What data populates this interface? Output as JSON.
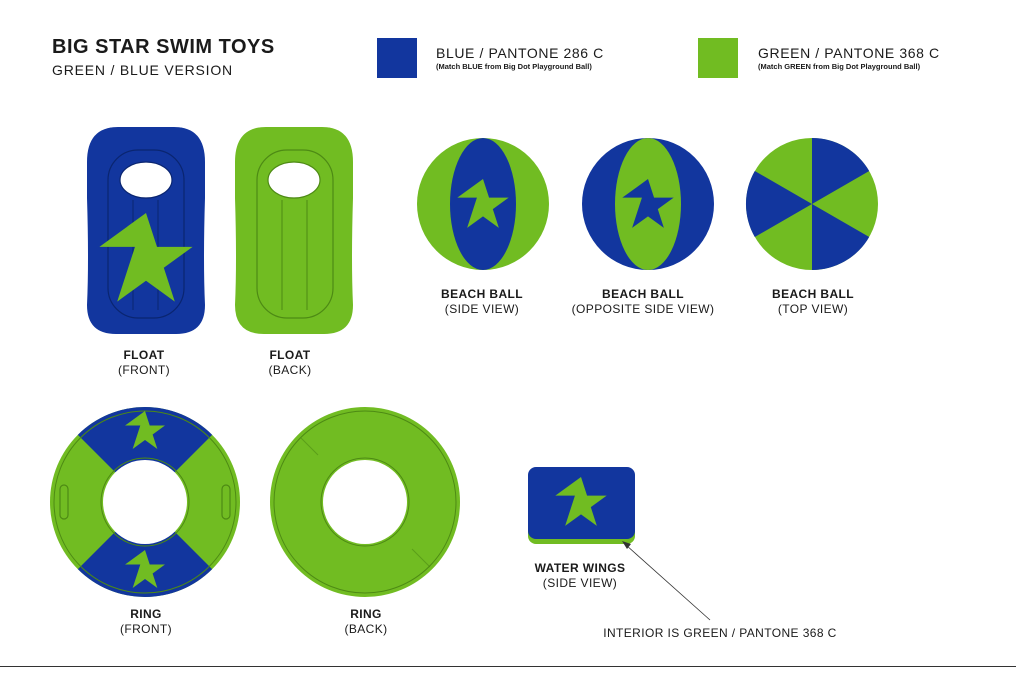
{
  "header": {
    "title": "BIG STAR SWIM TOYS",
    "subtitle": "GREEN / BLUE VERSION"
  },
  "colors": {
    "blue": "#12369e",
    "green": "#71bc22"
  },
  "swatches": [
    {
      "name": "BLUE / PANTONE 286 C",
      "note": "(Match BLUE from Big Dot Playground Ball)",
      "color": "#12369e"
    },
    {
      "name": "GREEN / PANTONE 368 C",
      "note": "(Match GREEN from Big Dot Playground Ball)",
      "color": "#71bc22"
    }
  ],
  "items": {
    "float_front": {
      "name": "FLOAT",
      "view": "(FRONT)"
    },
    "float_back": {
      "name": "FLOAT",
      "view": "(BACK)"
    },
    "ball_side": {
      "name": "BEACH BALL",
      "view": "(SIDE VIEW)"
    },
    "ball_opposite": {
      "name": "BEACH BALL",
      "view": "(OPPOSITE SIDE VIEW)"
    },
    "ball_top": {
      "name": "BEACH BALL",
      "view": "(TOP VIEW)"
    },
    "ring_front": {
      "name": "RING",
      "view": "(FRONT)"
    },
    "ring_back": {
      "name": "RING",
      "view": "(BACK)"
    },
    "wings": {
      "name": "WATER WINGS",
      "view": "(SIDE VIEW)"
    }
  },
  "annotation": "INTERIOR IS GREEN / PANTONE 368 C"
}
